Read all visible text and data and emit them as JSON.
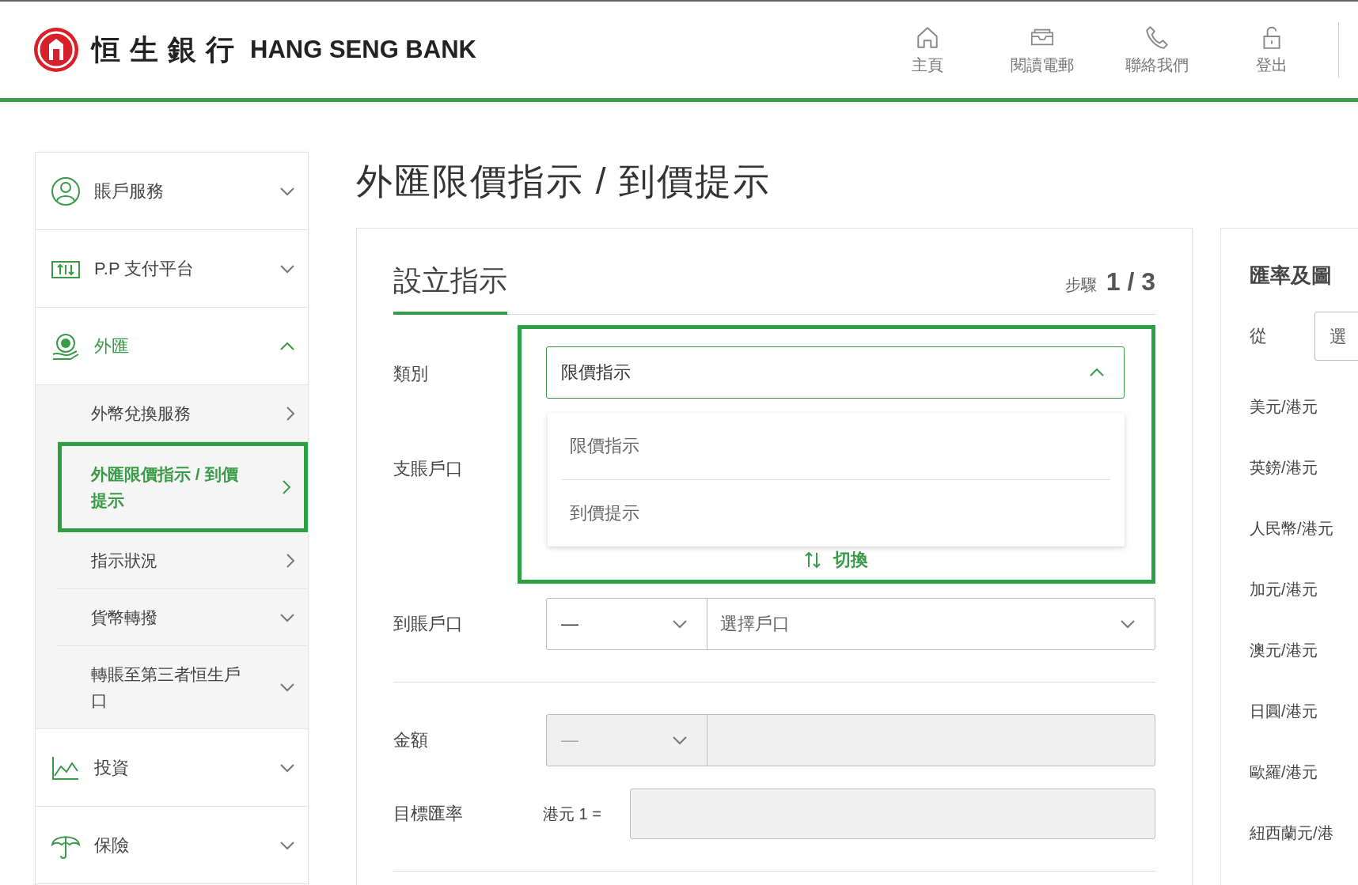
{
  "header": {
    "logo_chinese": "恒生銀行",
    "logo_english": "HANG SENG BANK",
    "nav": [
      {
        "label": "主頁",
        "kind": "home"
      },
      {
        "label": "閱讀電郵",
        "kind": "mail"
      },
      {
        "label": "聯絡我們",
        "kind": "phone"
      },
      {
        "label": "登出",
        "kind": "lock"
      }
    ]
  },
  "sidebar": {
    "items": [
      {
        "label": "賬戶服務",
        "kind": "account",
        "expanded": false
      },
      {
        "label": "P.P 支付平台",
        "kind": "payment",
        "expanded": false
      },
      {
        "label": "外匯",
        "kind": "fx",
        "expanded": true,
        "children": [
          {
            "label": "外幣兌換服務",
            "kind": "link",
            "selected": false,
            "highlighted": false
          },
          {
            "label": "外匯限價指示 / 到價提示",
            "kind": "link",
            "selected": true,
            "highlighted": true
          },
          {
            "label": "指示狀況",
            "kind": "link",
            "selected": false,
            "highlighted": false
          },
          {
            "label": "貨幣轉撥",
            "kind": "menu",
            "selected": false,
            "highlighted": false
          },
          {
            "label": "轉賬至第三者恒生戶口",
            "kind": "menu",
            "selected": false,
            "highlighted": false
          }
        ]
      },
      {
        "label": "投資",
        "kind": "chart",
        "expanded": false
      },
      {
        "label": "保險",
        "kind": "umbrella",
        "expanded": false
      }
    ]
  },
  "page_title": "外匯限價指示 / 到價提示",
  "form": {
    "tab": "設立指示",
    "step_label": "步驟",
    "step": "1 / 3",
    "type_field": {
      "label": "類別",
      "value": "限價指示",
      "open": true,
      "highlighted": true,
      "options": [
        {
          "label": "限價指示"
        },
        {
          "label": "到價提示"
        }
      ]
    },
    "debit_account": {
      "label": "支賬戶口"
    },
    "swap": "切換",
    "credit_account": {
      "label": "到賬戶口",
      "currency": "—",
      "placeholder": "選擇戶口",
      "disabled": false
    },
    "amount": {
      "label": "金額",
      "currency": "—",
      "disabled": true
    },
    "target_rate": {
      "label": "目標匯率",
      "prefix": "港元 1 =",
      "disabled": true
    }
  },
  "rates_panel": {
    "title": "匯率及圖",
    "from_label": "從",
    "from_placeholder": "選",
    "pairs": [
      "美元/港元",
      "英鎊/港元",
      "人民幣/港元",
      "加元/港元",
      "澳元/港元",
      "日圓/港元",
      "歐羅/港元",
      "紐西蘭元/港"
    ]
  }
}
